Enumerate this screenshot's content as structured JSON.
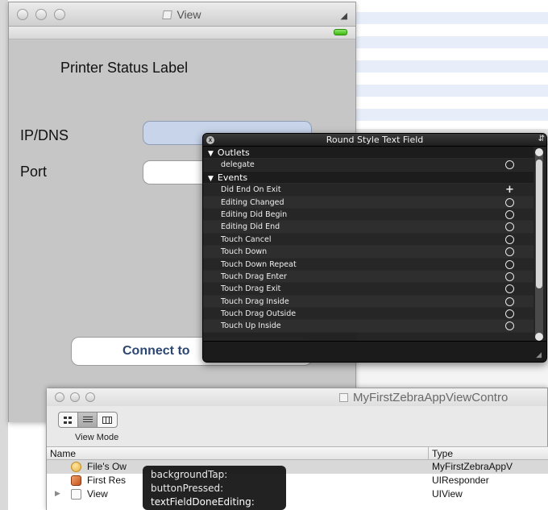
{
  "view_window": {
    "title": "View",
    "printer_status_label": "Printer Status Label",
    "ip_label": "IP/DNS",
    "port_label": "Port",
    "connect_button": "Connect to"
  },
  "hud": {
    "title": "Round Style Text Field",
    "sections": [
      {
        "label": "Outlets",
        "items": [
          {
            "label": "delegate",
            "marker": "circle"
          }
        ]
      },
      {
        "label": "Events",
        "items": [
          {
            "label": "Did End On Exit",
            "marker": "plus"
          },
          {
            "label": "Editing Changed",
            "marker": "circle"
          },
          {
            "label": "Editing Did Begin",
            "marker": "circle"
          },
          {
            "label": "Editing Did End",
            "marker": "circle"
          },
          {
            "label": "Touch Cancel",
            "marker": "circle"
          },
          {
            "label": "Touch Down",
            "marker": "circle"
          },
          {
            "label": "Touch Down Repeat",
            "marker": "circle"
          },
          {
            "label": "Touch Drag Enter",
            "marker": "circle"
          },
          {
            "label": "Touch Drag Exit",
            "marker": "circle"
          },
          {
            "label": "Touch Drag Inside",
            "marker": "circle"
          },
          {
            "label": "Touch Drag Outside",
            "marker": "circle"
          },
          {
            "label": "Touch Up Inside",
            "marker": "circle"
          }
        ]
      }
    ]
  },
  "nib_window": {
    "title": "MyFirstZebraAppViewContro",
    "view_mode_label": "View Mode",
    "columns": {
      "name": "Name",
      "type": "Type"
    },
    "rows": [
      {
        "name": "File's Ow",
        "type": "MyFirstZebraAppV",
        "icon": "files-owner-icon",
        "selected": true
      },
      {
        "name": "First Res",
        "type": "UIResponder",
        "icon": "first-responder-icon"
      },
      {
        "name": "View",
        "type": "UIView",
        "icon": "view-icon",
        "disclosure": true
      }
    ]
  },
  "action_popup": {
    "actions": [
      "backgroundTap:",
      "buttonPressed:",
      "textFieldDoneEditing:"
    ]
  }
}
